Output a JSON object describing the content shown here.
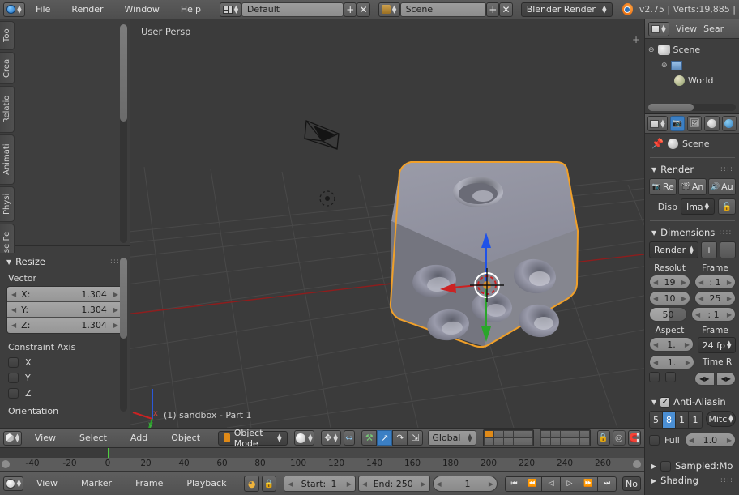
{
  "topbar": {
    "menus": [
      "File",
      "Render",
      "Window",
      "Help"
    ],
    "screen_layout": "Default",
    "scene_name": "Scene",
    "engine": "Blender Render",
    "status": "v2.75 | Verts:19,885 | ",
    "add_label": "+",
    "remove_label": "✕"
  },
  "tool_tabs": [
    "Too",
    "Crea",
    "Relatio",
    "Animati",
    "Physi",
    "Grease Pe"
  ],
  "resize_panel": {
    "title": "Resize",
    "vector_label": "Vector",
    "vector": [
      {
        "axis": "X:",
        "value": "1.304"
      },
      {
        "axis": "Y:",
        "value": "1.304"
      },
      {
        "axis": "Z:",
        "value": "1.304"
      }
    ],
    "constraint_label": "Constraint Axis",
    "constraints": [
      "X",
      "Y",
      "Z"
    ],
    "orientation_label": "Orientation"
  },
  "viewport": {
    "view_label": "User Persp",
    "object_info": "(1) sandbox - Part 1",
    "axis_x": "x",
    "axis_y": "y",
    "colors": {
      "background": "#3b3b3b",
      "object": "#8b8c99",
      "selection_outline": "#f0a02a",
      "axis_x": "#b52020",
      "axis_y": "#2aa62a",
      "manip_z": "#1f52e8"
    }
  },
  "viewport_header": {
    "menus": [
      "View",
      "Select",
      "Add",
      "Object"
    ],
    "mode": "Object Mode",
    "transform_orientation": "Global"
  },
  "outliner": {
    "menus": [
      "View",
      "Sear"
    ],
    "items": [
      "Scene",
      "World"
    ]
  },
  "properties": {
    "scene_name": "Scene",
    "render": {
      "title": "Render",
      "buttons": [
        "Re",
        "An",
        "Au"
      ],
      "display_label": "Disp",
      "display_value": "Ima"
    },
    "dimensions": {
      "title": "Dimensions",
      "preset": "Render",
      "col_left": "Resolut",
      "col_right": "Frame",
      "res_x": "19",
      "res_y": "10",
      "res_percent": "50",
      "frame_start": ": 1",
      "frame_end": "25",
      "frame_step": ": 1",
      "aspect_label": "Aspect",
      "frame_rate_label": "Frame",
      "aspect_x": "1.",
      "aspect_y": "1.",
      "fps": "24 fp",
      "time_remap_label": "Time R"
    },
    "antialiasing": {
      "title": "Anti-Aliasin",
      "samples": [
        "5",
        "8",
        "1",
        "1"
      ],
      "selected_sample": "8",
      "filter": "Mitc",
      "full_sample_label": "Full",
      "filter_size": "1.0"
    },
    "sampled_motion": "Sampled:Mo",
    "shading": "Shading"
  },
  "timeline": {
    "menus": [
      "View",
      "Marker",
      "Frame",
      "Playback"
    ],
    "start_label": "Start:",
    "start_value": "1",
    "end_label": "End:",
    "end_value": "250",
    "current_frame": "1",
    "sync_label": "No",
    "ticks": [
      "-40",
      "-20",
      "0",
      "20",
      "40",
      "60",
      "80",
      "100",
      "120",
      "140",
      "160",
      "180",
      "200",
      "220",
      "240",
      "260"
    ],
    "playback_icons": [
      "⏮",
      "⏪",
      "◁",
      "▷",
      "⏩",
      "⏭"
    ]
  }
}
